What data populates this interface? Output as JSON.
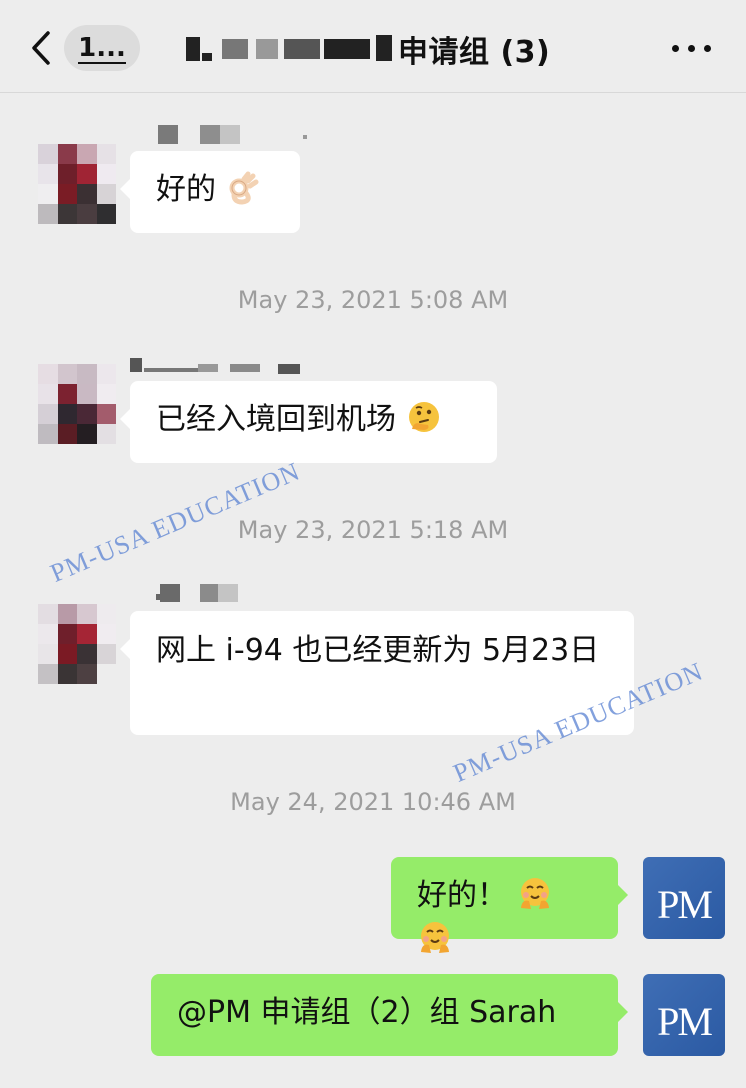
{
  "header": {
    "unread_count": "1...",
    "title": "申请组 (3)"
  },
  "messages": [
    {
      "text": "好的"
    },
    {
      "timestamp": "May 23, 2021 5:08 AM"
    },
    {
      "text": "已经入境回到机场"
    },
    {
      "timestamp": "May 23, 2021 5:18 AM"
    },
    {
      "text": "网上 i-94 也已经更新为 5月23日"
    },
    {
      "timestamp": "May 24, 2021 10:46 AM"
    },
    {
      "text": "好的！"
    },
    {
      "text": "@PM 申请组（2）组 Sarah"
    }
  ],
  "avatar_text": "PM",
  "watermark": "PM-USA EDUCATION",
  "icons": {
    "back": "chevron-left-icon",
    "more": "more-dots-icon",
    "ok_hand": "ok-hand-emoji",
    "thinking": "thinking-emoji",
    "blush": "hugging-face-emoji"
  },
  "colors": {
    "background": "#ededed",
    "incoming_bubble": "#ffffff",
    "outgoing_bubble": "#95ec69",
    "timestamp": "#9d9d9d",
    "avatar_blue": "#2b5aa3",
    "watermark": "#5a82d2"
  }
}
